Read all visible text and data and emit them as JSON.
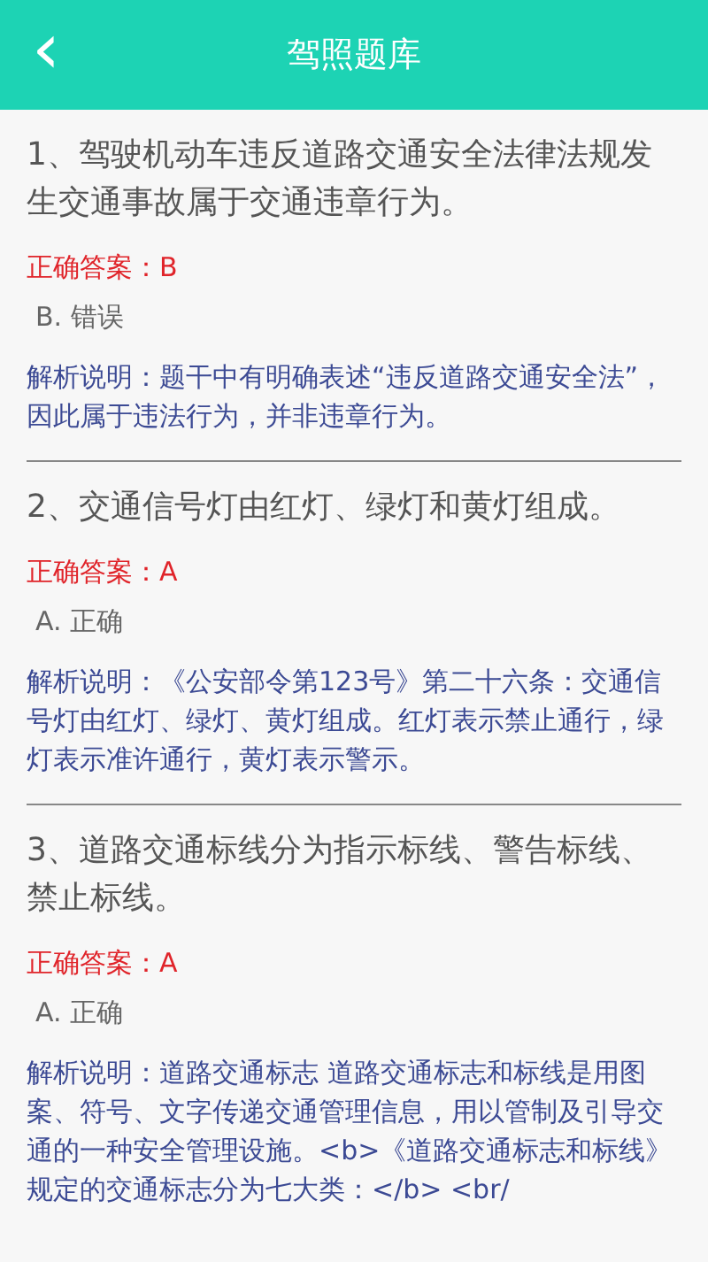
{
  "header": {
    "back_icon": "‹",
    "title": "驾照题库"
  },
  "questions": [
    {
      "question": "1、驾驶机动车违反道路交通安全法律法规发生交通事故属于交通违章行为。",
      "answer": "正确答案：B",
      "option": "B. 错误",
      "explanation": "解析说明：题干中有明确表述“违反道路交通安全法”，因此属于违法行为，并非违章行为。"
    },
    {
      "question": "2、交通信号灯由红灯、绿灯和黄灯组成。",
      "answer": "正确答案：A",
      "option": "A. 正确",
      "explanation": "解析说明：《公安部令第123号》第二十六条：交通信号灯由红灯、绿灯、黄灯组成。红灯表示禁止通行，绿灯表示准许通行，黄灯表示警示。"
    },
    {
      "question": "3、道路交通标线分为指示标线、警告标线、禁止标线。",
      "answer": "正确答案：A",
      "option": "A. 正确",
      "explanation": "解析说明：道路交通标志  道路交通标志和标线是用图案、符号、文字传递交通管理信息，用以管制及引导交通的一种安全管理设施。<b>《道路交通标志和标线》规定的交通标志分为七大类：</b> <br/"
    }
  ]
}
